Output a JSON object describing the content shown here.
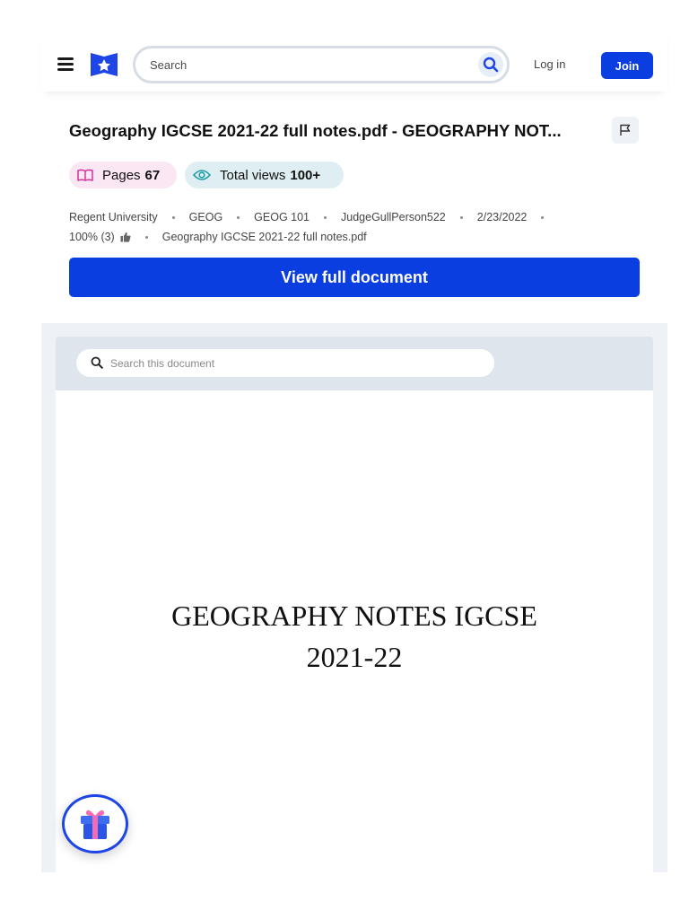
{
  "header": {
    "search_placeholder": "Search",
    "login_label": "Log in",
    "join_label": "Join"
  },
  "document": {
    "title": "Geography IGCSE 2021-22 full notes.pdf - GEOGRAPHY NOT...",
    "pages_label": "Pages",
    "pages_value": "67",
    "views_label": "Total views",
    "views_value": "100+",
    "meta": {
      "university": "Regent University",
      "subject": "GEOG",
      "course": "GEOG 101",
      "author": "JudgeGullPerson522",
      "date": "2/23/2022",
      "rating": "100% (3)",
      "filename": "Geography IGCSE 2021-22 full notes.pdf"
    },
    "view_full_label": "View full document"
  },
  "viewer": {
    "search_placeholder": "Search this document",
    "page_heading_line1": "GEOGRAPHY NOTES IGCSE",
    "page_heading_line2": "2021-22"
  },
  "colors": {
    "brand_blue": "#0b3ee0",
    "pages_pill_bg": "#fbe6f3",
    "views_pill_bg": "#dfeef2",
    "pages_icon": "#d6339a",
    "views_icon": "#1a9aa8"
  },
  "icons": {
    "menu": "hamburger-icon",
    "logo": "star-bookmark-logo",
    "search": "search-icon",
    "flag": "flag-icon",
    "pages": "book-icon",
    "views": "eye-icon",
    "rating": "thumbs-up-icon",
    "gift": "gift-icon"
  }
}
